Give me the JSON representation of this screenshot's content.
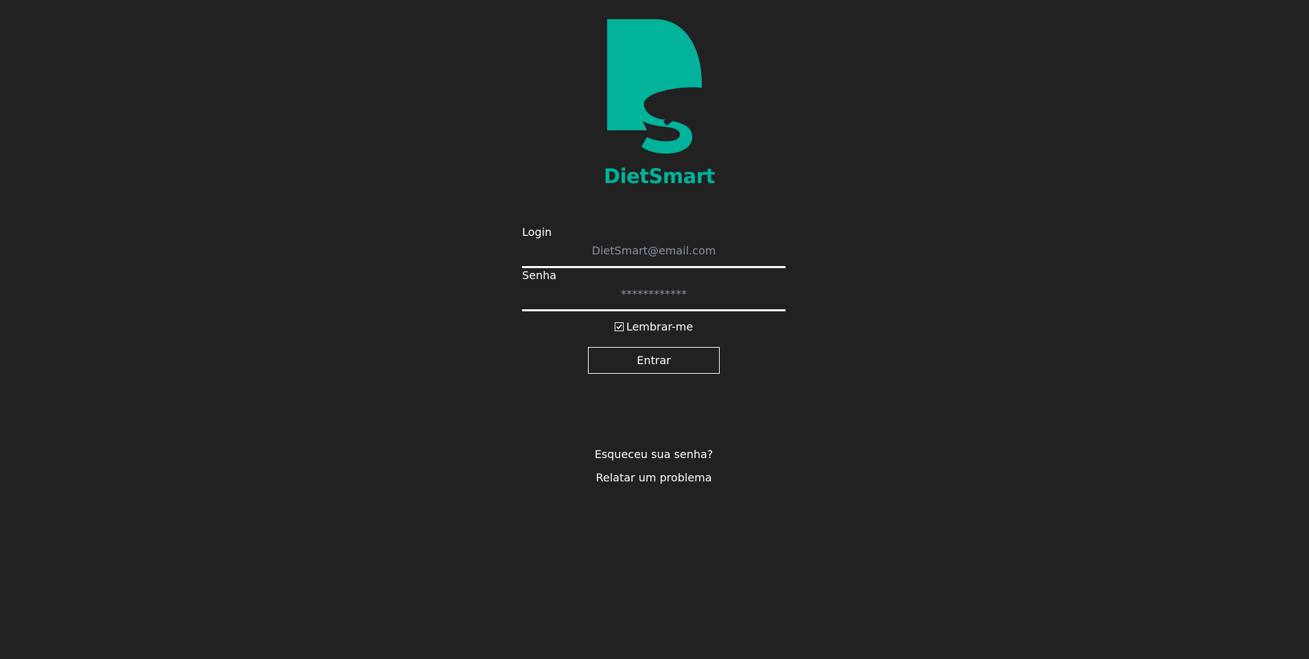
{
  "app": {
    "brand_name": "DietSmart",
    "accent_color": "#00b39a",
    "background_color": "#212121"
  },
  "login_form": {
    "login_label": "Login",
    "login_placeholder": "DietSmart@email.com",
    "password_label": "Senha",
    "password_placeholder": "************",
    "remember_label": "Lembrar-me",
    "remember_checked": true,
    "submit_label": "Entrar"
  },
  "links": {
    "forgot_password": "Esqueceu sua senha?",
    "report_problem": "Relatar um problema"
  }
}
